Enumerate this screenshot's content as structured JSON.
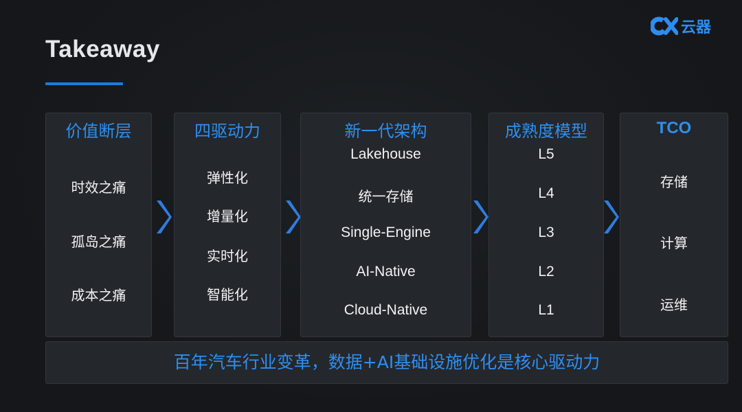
{
  "title": "Takeaway",
  "logo": {
    "text": "云器",
    "brand_color": "#2d8cf0"
  },
  "accent_color": "#1f7ae0",
  "columns": [
    {
      "heading": "价值断层",
      "items": [
        "时效之痛",
        "孤岛之痛",
        "成本之痛"
      ]
    },
    {
      "heading": "四驱动力",
      "items": [
        "弹性化",
        "增量化",
        "实时化",
        "智能化"
      ]
    },
    {
      "heading": "新一代架构",
      "items": [
        "Lakehouse",
        "统一存储",
        "Single-Engine",
        "AI-Native",
        "Cloud-Native"
      ]
    },
    {
      "heading": "成熟度模型",
      "items": [
        "L5",
        "L4",
        "L3",
        "L2",
        "L1"
      ]
    },
    {
      "heading": "TCO",
      "items": [
        "存储",
        "计算",
        "运维"
      ]
    }
  ],
  "footer": "百年汽车行业变革，数据+AI基础设施优化是核心驱动力"
}
